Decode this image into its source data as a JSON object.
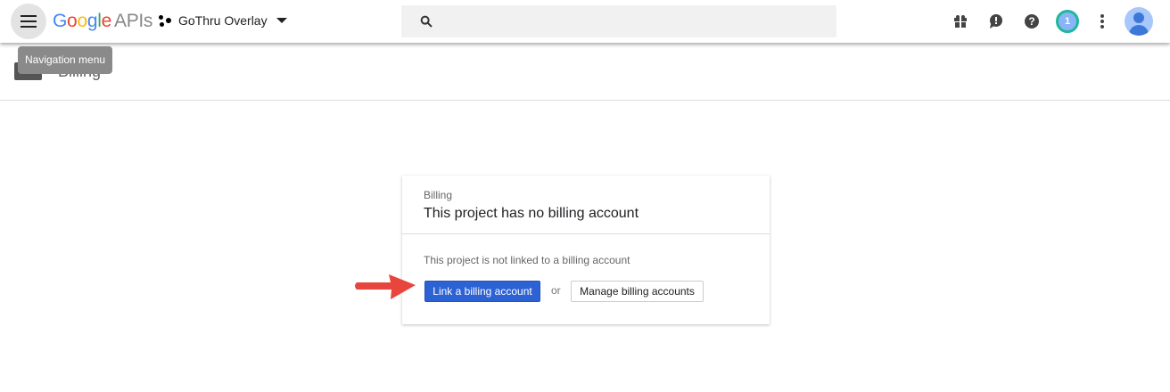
{
  "header": {
    "logo_google": "Google",
    "logo_apis": "APIs",
    "project_name": "GoThru Overlay",
    "search_placeholder": "",
    "notification_count": "1"
  },
  "tooltip": "Navigation menu",
  "page_title": "Billing",
  "card": {
    "label": "Billing",
    "title": "This project has no billing account",
    "message": "This project is not linked to a billing account",
    "link_button": "Link a billing account",
    "or_text": "or",
    "manage_button": "Manage billing accounts"
  },
  "colors": {
    "accent": "#2d62d4",
    "arrow": "#e8453c",
    "badge_ring": "#1fb89a"
  }
}
